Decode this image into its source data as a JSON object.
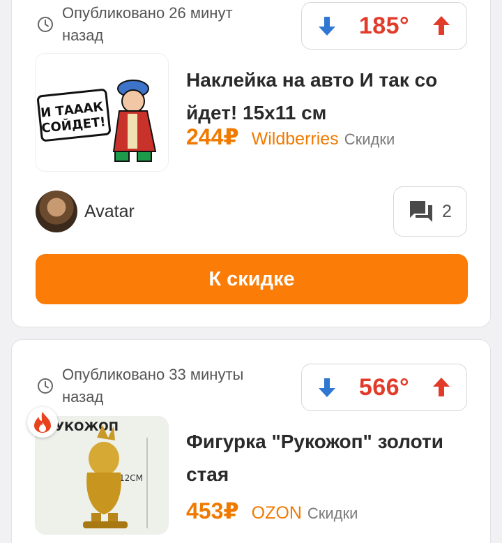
{
  "deals": [
    {
      "published": "Опубликовано 26 минут назад",
      "temperature": "185°",
      "title": "Наклейка на авто И так со йдет! 15х11 см",
      "price": "244₽",
      "shop": "Wildberries",
      "category": "Скидки",
      "image_caption": "И ТАААК СОЙДЕТ!",
      "author": "Avatar",
      "comments_count": "2",
      "cta_label": "К скидке"
    },
    {
      "published": "Опубликовано 33 минуты назад",
      "temperature": "566°",
      "title": "Фигурка \"Рукожоп\" золоти стая",
      "price": "453₽",
      "shop": "OZON",
      "category": "Скидки",
      "image_caption": "УКОЖОП",
      "image_size": "12СМ",
      "hot": true
    }
  ],
  "icons": {
    "clock": "clock-icon",
    "vote_down": "arrow-down-icon",
    "vote_up": "arrow-up-icon",
    "comments": "comments-icon",
    "hot": "fire-icon"
  },
  "colors": {
    "accent": "#fb7c06",
    "price": "#f07a00",
    "temperature": "#e23b2a",
    "down_arrow": "#2f77d0",
    "up_arrow": "#e23b2a"
  }
}
